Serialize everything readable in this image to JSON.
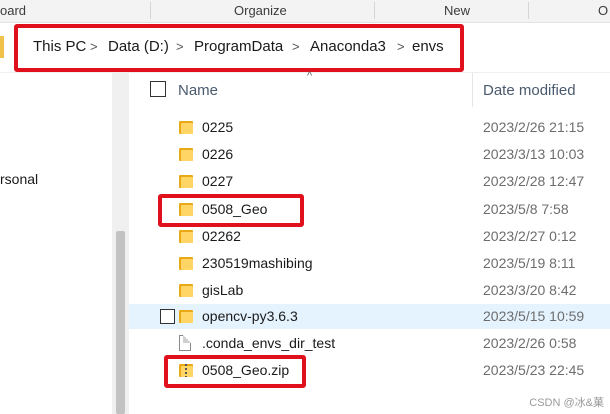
{
  "ribbon": {
    "groups": [
      "oard",
      "Organize",
      "New",
      "O"
    ]
  },
  "address": {
    "crumbs": [
      "This PC",
      "Data (D:)",
      "ProgramData",
      "Anaconda3",
      "envs"
    ],
    "separator": ">"
  },
  "nav": {
    "items": [
      "rsonal"
    ]
  },
  "list": {
    "header": {
      "name": "Name",
      "date": "Date modified",
      "sort_indicator": "^"
    },
    "rows": [
      {
        "name": "0225",
        "date": "2023/2/26 21:15",
        "type": "folder"
      },
      {
        "name": "0226",
        "date": "2023/3/13 10:03",
        "type": "folder"
      },
      {
        "name": "0227",
        "date": "2023/2/28 12:47",
        "type": "folder"
      },
      {
        "name": "0508_Geo",
        "date": "2023/5/8 7:58",
        "type": "folder"
      },
      {
        "name": "02262",
        "date": "2023/2/27 0:12",
        "type": "folder"
      },
      {
        "name": "230519mashibing",
        "date": "2023/5/19 8:11",
        "type": "folder"
      },
      {
        "name": "gisLab",
        "date": "2023/3/20 8:42",
        "type": "folder"
      },
      {
        "name": "opencv-py3.6.3",
        "date": "2023/5/15 10:59",
        "type": "folder",
        "selected": true
      },
      {
        "name": ".conda_envs_dir_test",
        "date": "2023/2/26 0:58",
        "type": "file"
      },
      {
        "name": "0508_Geo.zip",
        "date": "2023/5/23 22:45",
        "type": "zip"
      }
    ]
  },
  "watermark": "CSDN @冰&菓",
  "colors": {
    "highlight": "#e0101d",
    "selected_row": "#e5f3ff",
    "folder": "#ffd665"
  }
}
